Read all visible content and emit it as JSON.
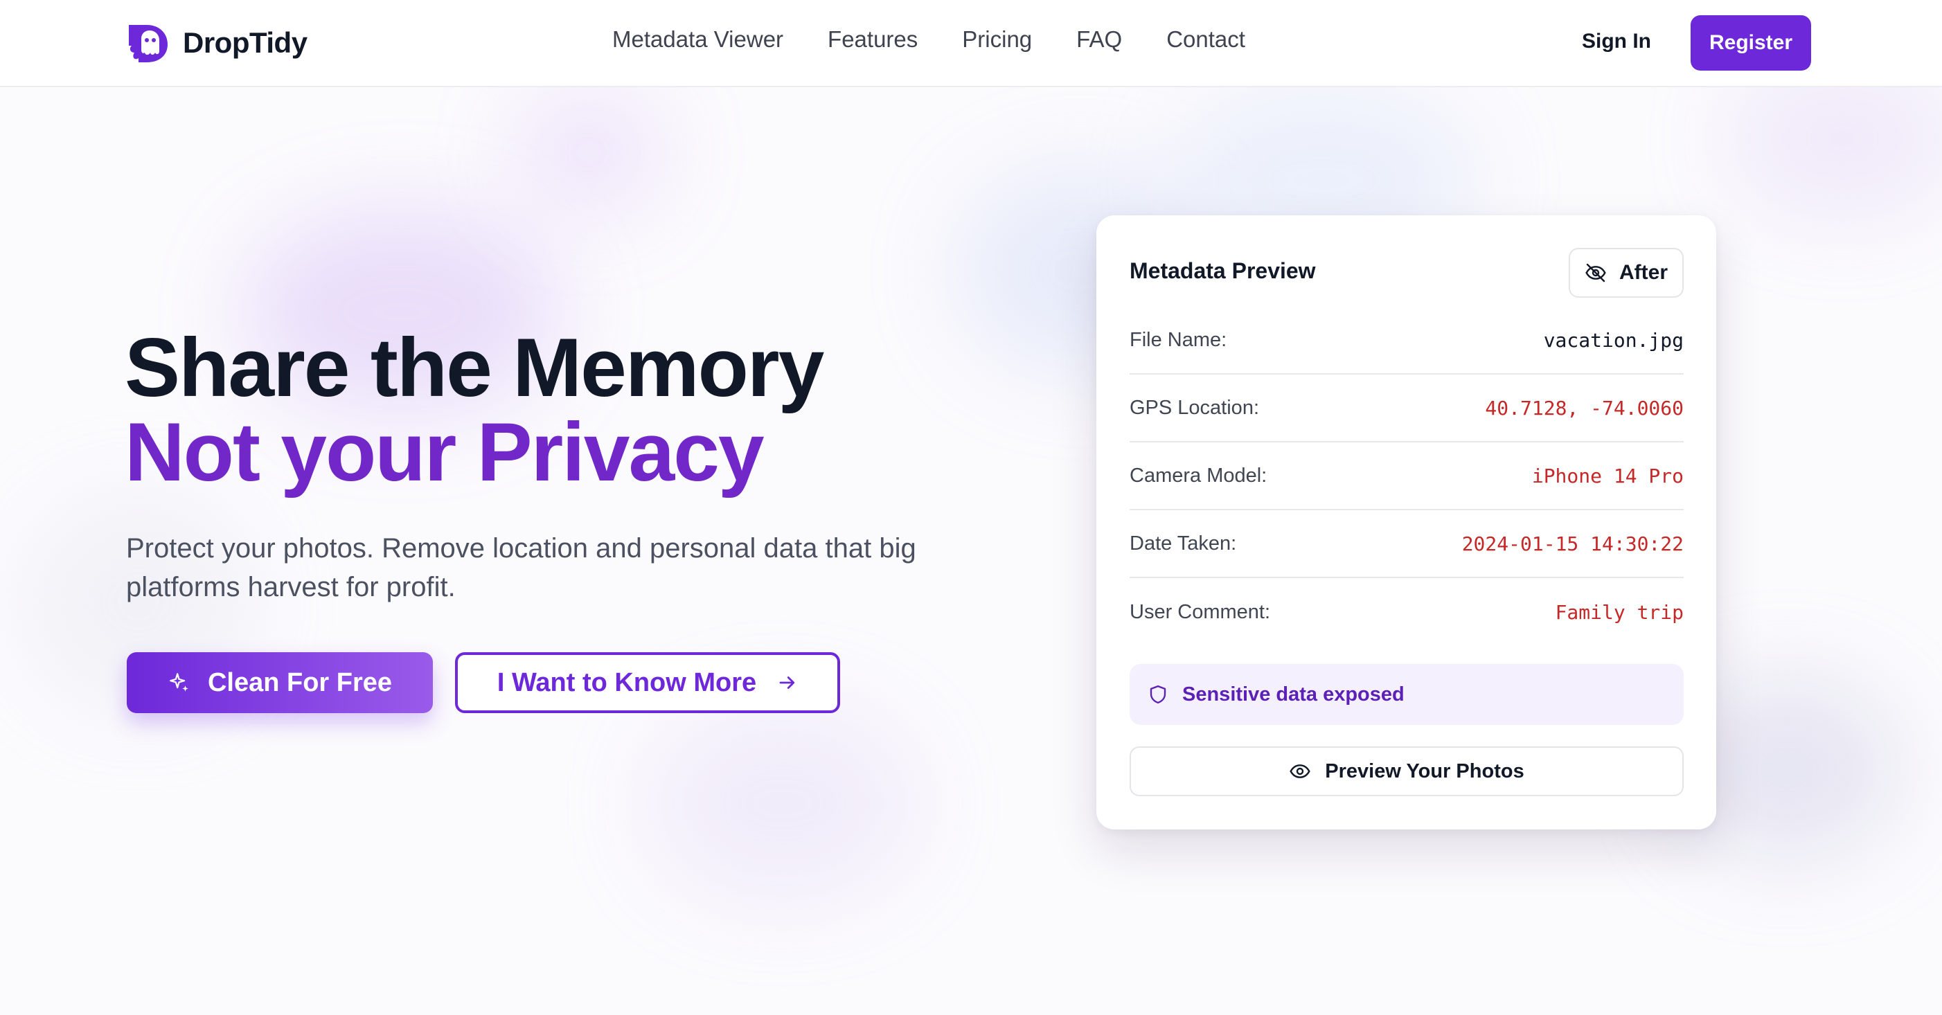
{
  "brand": {
    "name": "DropTidy",
    "logo_icon": "ghost-logo-icon",
    "accent": "#6d28d9"
  },
  "nav": {
    "items": [
      {
        "label": "Metadata Viewer"
      },
      {
        "label": "Features"
      },
      {
        "label": "Pricing"
      },
      {
        "label": "FAQ"
      },
      {
        "label": "Contact"
      }
    ],
    "sign_in": "Sign In",
    "register": "Register"
  },
  "hero": {
    "title_line1": "Share the Memory",
    "title_line2": "Not your Privacy",
    "subtitle": "Protect your photos. Remove location and personal data that big platforms harvest for profit.",
    "primary_cta": "Clean For Free",
    "primary_icon": "sparkle-icon",
    "secondary_cta": "I Want to Know More",
    "secondary_icon": "arrow-right-icon"
  },
  "preview_card": {
    "title": "Metadata Preview",
    "toggle_label": "After",
    "toggle_icon": "eye-off-icon",
    "rows": [
      {
        "label": "File Name:",
        "value": "vacation.jpg",
        "sensitive": false
      },
      {
        "label": "GPS Location:",
        "value": "40.7128, -74.0060",
        "sensitive": true
      },
      {
        "label": "Camera Model:",
        "value": "iPhone 14 Pro",
        "sensitive": true
      },
      {
        "label": "Date Taken:",
        "value": "2024-01-15 14:30:22",
        "sensitive": true
      },
      {
        "label": "User Comment:",
        "value": "Family trip",
        "sensitive": true
      }
    ],
    "alert_text": "Sensitive data exposed",
    "alert_icon": "shield-icon",
    "preview_button": "Preview Your Photos",
    "preview_icon": "eye-icon",
    "sensitive_color": "#c62828"
  }
}
